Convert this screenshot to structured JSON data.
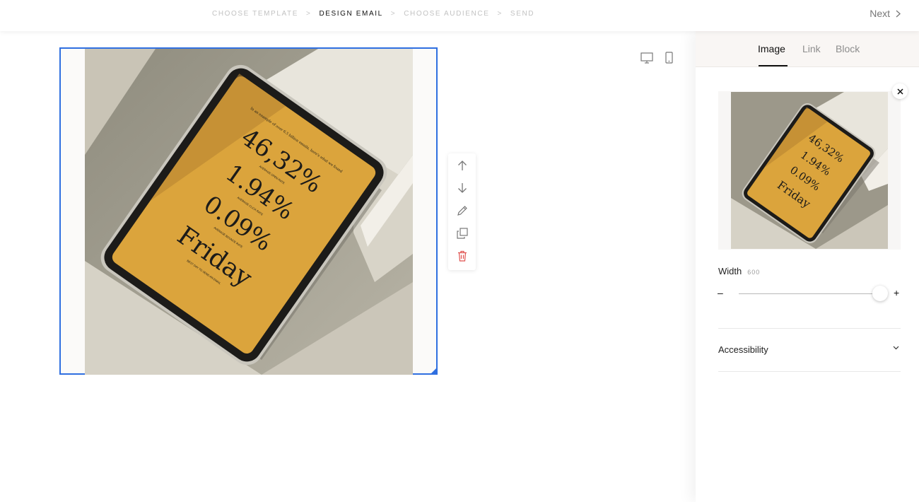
{
  "steps": [
    {
      "label": "CHOOSE TEMPLATE",
      "active": false
    },
    {
      "label": "DESIGN EMAIL",
      "active": true
    },
    {
      "label": "CHOOSE AUDIENCE",
      "active": false
    },
    {
      "label": "SEND",
      "active": false
    }
  ],
  "step_separator": ">",
  "next_label": "Next",
  "panel": {
    "tabs": [
      {
        "label": "Image",
        "active": true
      },
      {
        "label": "Link",
        "active": false
      },
      {
        "label": "Block",
        "active": false
      }
    ],
    "width_label": "Width",
    "width_value": "600",
    "slider_level": 1.0,
    "minus": "–",
    "plus": "+",
    "accordion_label": "Accessibility"
  },
  "image_text": {
    "intro": "In an example of over 6.5 billion emails, here's what we found",
    "stat1": "46,32%",
    "stat1_caption": "AVERAGE OPEN RATE",
    "stat2": "1.94%",
    "stat2_caption": "AVERAGE CLICK RATE",
    "stat3": "0.09%",
    "stat3_caption": "AVERAGE BOUNCE RATE",
    "stat4": "Friday",
    "stat4_caption": "BEST DAY TO SEND AN EMAIL"
  },
  "icons": {
    "desktop": "desktop-icon",
    "mobile": "mobile-icon",
    "move_up": "arrow-up-icon",
    "move_down": "arrow-down-icon",
    "edit": "pencil-icon",
    "duplicate": "duplicate-icon",
    "delete": "trash-icon",
    "close": "close-icon",
    "chevron": "chevron-down-icon",
    "next": "chevron-right-icon"
  },
  "colors": {
    "accent": "#2f6fe0",
    "tablet_screen": "#dba43c",
    "delete": "#e0524f"
  }
}
